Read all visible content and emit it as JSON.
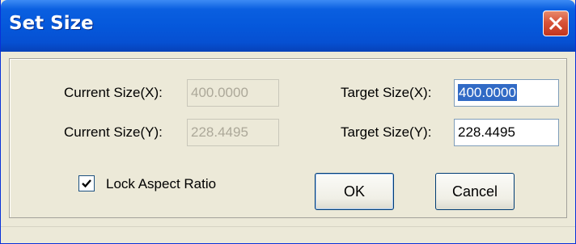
{
  "window": {
    "title": "Set Size"
  },
  "current": {
    "x_label": "Current Size(X):",
    "x_value": "400.0000",
    "y_label": "Current Size(Y):",
    "y_value": "228.4495"
  },
  "target": {
    "x_label": "Target Size(X):",
    "x_value": "400.0000",
    "y_label": "Target Size(Y):",
    "y_value": "228.4495"
  },
  "lock": {
    "label": "Lock Aspect Ratio",
    "checked": true
  },
  "buttons": {
    "ok": "OK",
    "cancel": "Cancel"
  },
  "colors": {
    "titlebar": "#0558db",
    "close": "#d8543a",
    "dialog_bg": "#ece9d8",
    "selection": "#316ac5"
  }
}
